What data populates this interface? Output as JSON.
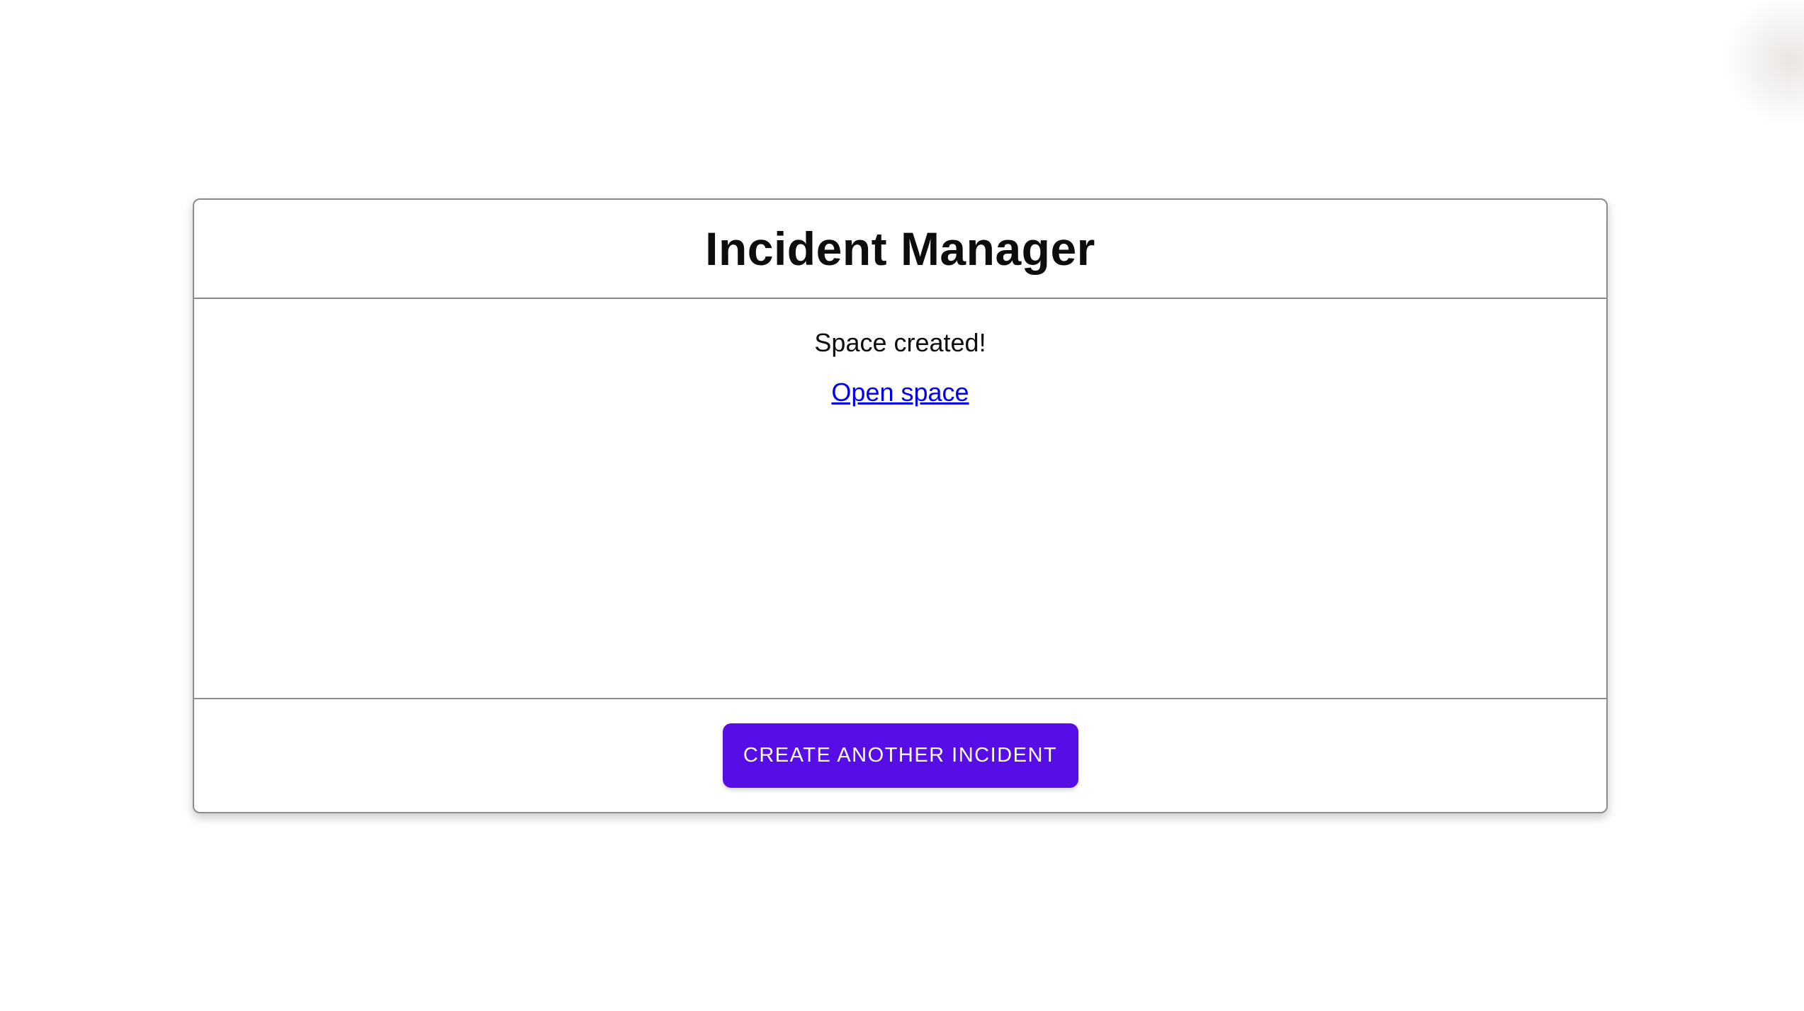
{
  "card": {
    "title": "Incident Manager",
    "body": {
      "status_message": "Space created!",
      "open_space_link": "Open space"
    },
    "footer": {
      "create_incident_button": "CREATE ANOTHER INCIDENT"
    }
  },
  "colors": {
    "button_background": "#560de6",
    "button_text": "#ffffff",
    "link_color": "#0000ee",
    "border_color": "#8c8c8c"
  }
}
